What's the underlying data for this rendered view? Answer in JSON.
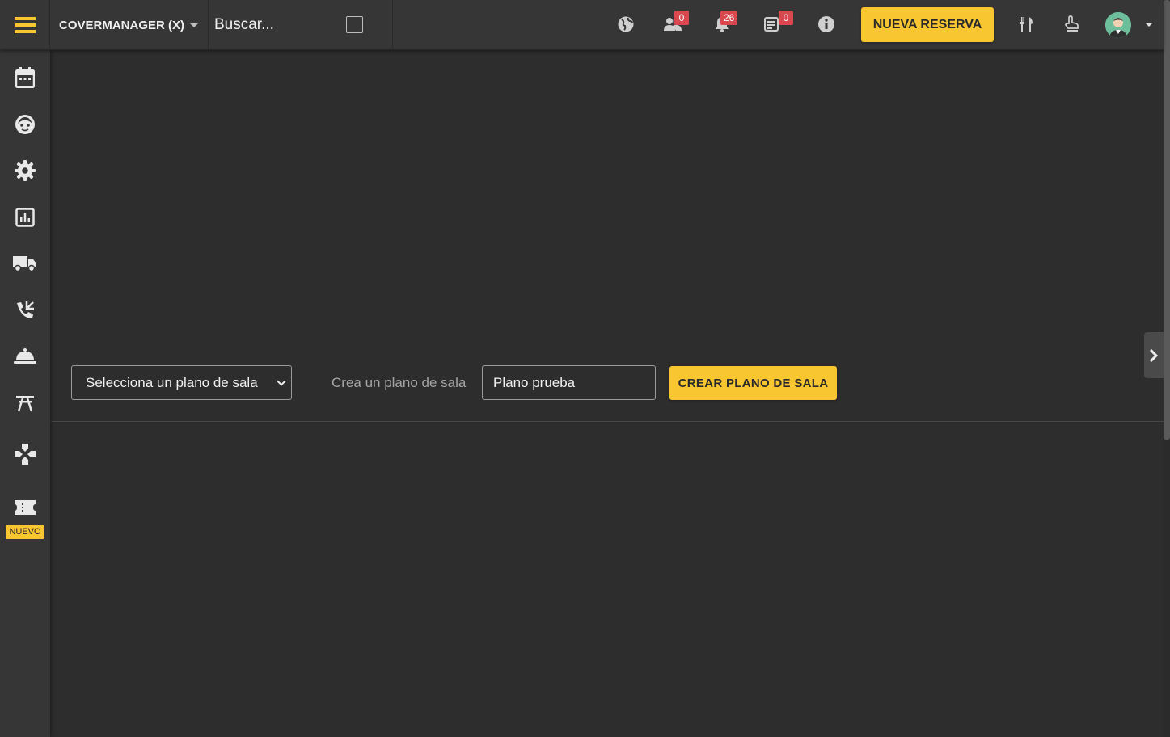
{
  "header": {
    "brand": "COVERMANAGER (X)",
    "search_placeholder": "Buscar...",
    "badges": {
      "clients": "0",
      "notifications": "26",
      "messages": "0"
    },
    "new_reservation_label": "NUEVA RESERVA"
  },
  "sidebar": {
    "items": [
      {
        "icon": "calendar-icon"
      },
      {
        "icon": "face-icon"
      },
      {
        "icon": "gear-icon"
      },
      {
        "icon": "chart-icon"
      },
      {
        "icon": "truck-icon"
      },
      {
        "icon": "phone-icon"
      },
      {
        "icon": "cloche-icon"
      },
      {
        "icon": "torii-icon"
      },
      {
        "icon": "gamepad-icon"
      },
      {
        "icon": "ticket-icon"
      }
    ],
    "nuevo_tag": "NUEVO"
  },
  "plan": {
    "select_value": "Selecciona un plano de sala",
    "create_label": "Crea un plano de sala",
    "input_value": "Plano prueba",
    "create_button": "CREAR PLANO DE SALA"
  },
  "colors": {
    "accent": "#f8c630",
    "badge": "#d9484f",
    "bg": "#2d2d2d",
    "bar": "#363636"
  }
}
